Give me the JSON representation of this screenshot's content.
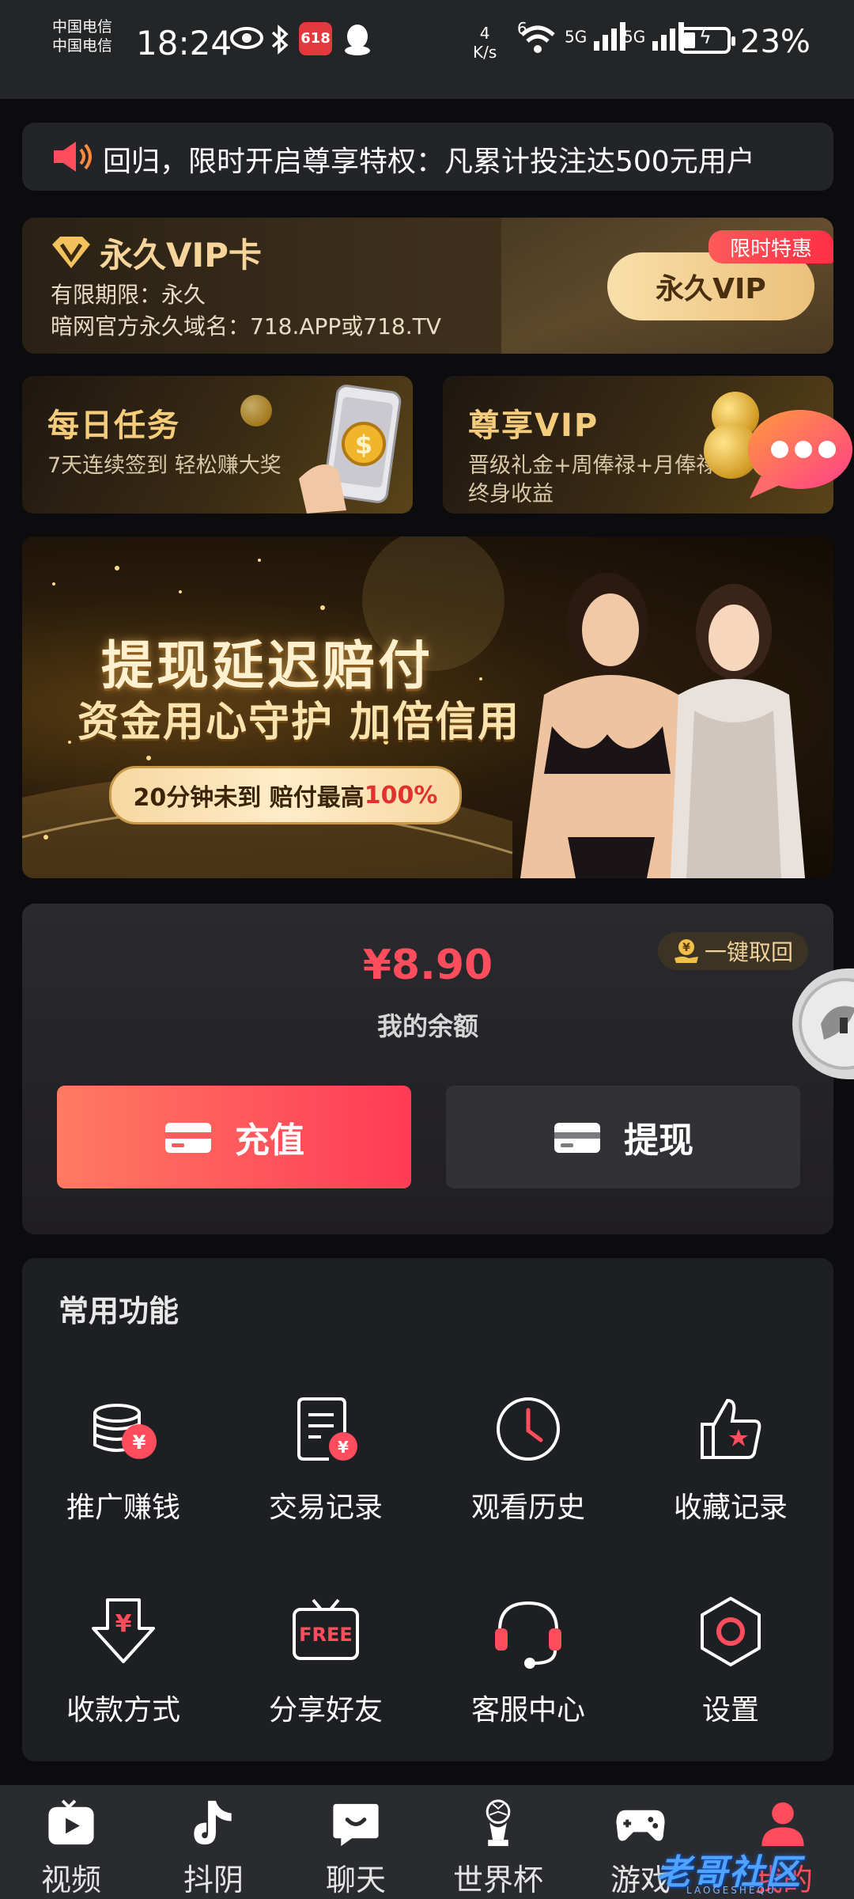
{
  "status_bar": {
    "carrier_line1": "中国电信",
    "carrier_line2": "中国电信",
    "time": "18:24",
    "net_speed_value": "4",
    "net_speed_unit": "K/s",
    "wifi_gen": "6",
    "sim1_gen": "5G",
    "sim2_gen": "5G",
    "app_badge": "618",
    "battery": "23%",
    "battery_level": 0.23
  },
  "marquee": {
    "text": "回归，限时开启尊享特权：凡累计投注达500元用户"
  },
  "vip_card": {
    "title": "永久VIP卡",
    "line1": "有限期限：永久",
    "line2": "暗网官方永久域名：718.APP或718.TV",
    "button": "永久VIP",
    "tag": "限时特惠"
  },
  "promos": [
    {
      "title": "每日任务",
      "subtitle": "7天连续签到 轻松赚大奖"
    },
    {
      "title": "尊享VIP",
      "subtitle_line1": "晋级礼金+周俸禄+月俸禄",
      "subtitle_line2": "终身收益"
    }
  ],
  "banner": {
    "headline": "提现延迟赔付",
    "subheadline": "资金用心守护 加倍信用",
    "pill_text": "20分钟未到 赔付最高",
    "pill_highlight": "100%"
  },
  "wallet": {
    "balance": "¥8.90",
    "balance_label": "我的余额",
    "recall_button": "一键取回",
    "recharge_button": "充值",
    "withdraw_button": "提现"
  },
  "features": {
    "title": "常用功能",
    "items": [
      {
        "label": "推广赚钱",
        "icon": "coins-icon"
      },
      {
        "label": "交易记录",
        "icon": "receipt-icon"
      },
      {
        "label": "观看历史",
        "icon": "clock-icon"
      },
      {
        "label": "收藏记录",
        "icon": "thumb-star-icon"
      },
      {
        "label": "收款方式",
        "icon": "yen-arrow-icon"
      },
      {
        "label": "分享好友",
        "icon": "free-tv-icon"
      },
      {
        "label": "客服中心",
        "icon": "headset-icon"
      },
      {
        "label": "设置",
        "icon": "hexagon-settings-icon"
      }
    ],
    "free_badge": "FREE"
  },
  "bottom_nav": {
    "items": [
      {
        "label": "视频",
        "icon": "video-icon"
      },
      {
        "label": "抖阴",
        "icon": "tiktok-icon"
      },
      {
        "label": "聊天",
        "icon": "chat-icon"
      },
      {
        "label": "世界杯",
        "icon": "trophy-icon"
      },
      {
        "label": "游戏",
        "icon": "gamepad-icon"
      },
      {
        "label": "我的",
        "icon": "profile-icon"
      }
    ],
    "active": "我的"
  },
  "watermark": {
    "text": "老哥社区",
    "sub": "LAOGESHEQU"
  },
  "colors": {
    "accent_red": "#ff4d5e",
    "gold": "#f4cc7c",
    "background": "#0c0c0e"
  }
}
